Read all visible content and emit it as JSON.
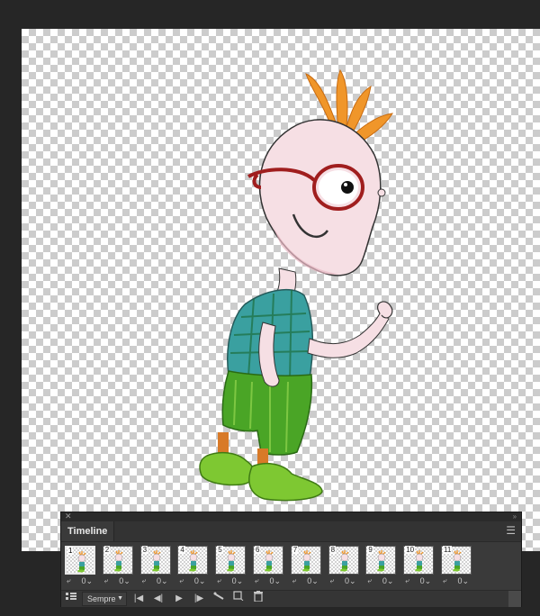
{
  "canvas": {
    "subject": "cartoon-character"
  },
  "timeline": {
    "title": "Timeline",
    "menu_icon": "panel-menu-icon",
    "close_icon": "close-icon",
    "frames": [
      {
        "number": "1",
        "delay": "0"
      },
      {
        "number": "2",
        "delay": "0"
      },
      {
        "number": "3",
        "delay": "0"
      },
      {
        "number": "4",
        "delay": "0"
      },
      {
        "number": "5",
        "delay": "0"
      },
      {
        "number": "6",
        "delay": "0"
      },
      {
        "number": "7",
        "delay": "0"
      },
      {
        "number": "8",
        "delay": "0"
      },
      {
        "number": "9",
        "delay": "0"
      },
      {
        "number": "10",
        "delay": "0"
      },
      {
        "number": "11",
        "delay": "0"
      }
    ],
    "selected_frame": "1",
    "loop_option": "Sempre",
    "controls": {
      "convert_icon": "convert-to-video-timeline-icon",
      "first_frame_icon": "first-frame-icon",
      "prev_frame_icon": "previous-frame-icon",
      "play_icon": "play-icon",
      "next_frame_icon": "next-frame-icon",
      "tween_icon": "tween-icon",
      "duplicate_icon": "duplicate-frame-icon",
      "delete_icon": "trash-icon"
    }
  },
  "colors": {
    "app_bg": "#262626",
    "panel_bg": "#3a3a3a",
    "hair": "#f0962a",
    "glasses": "#a01e1e",
    "shirt": "#3aa0a0",
    "shorts": "#4aa526",
    "shoes": "#7ec832",
    "skin": "#f6dfe4"
  }
}
